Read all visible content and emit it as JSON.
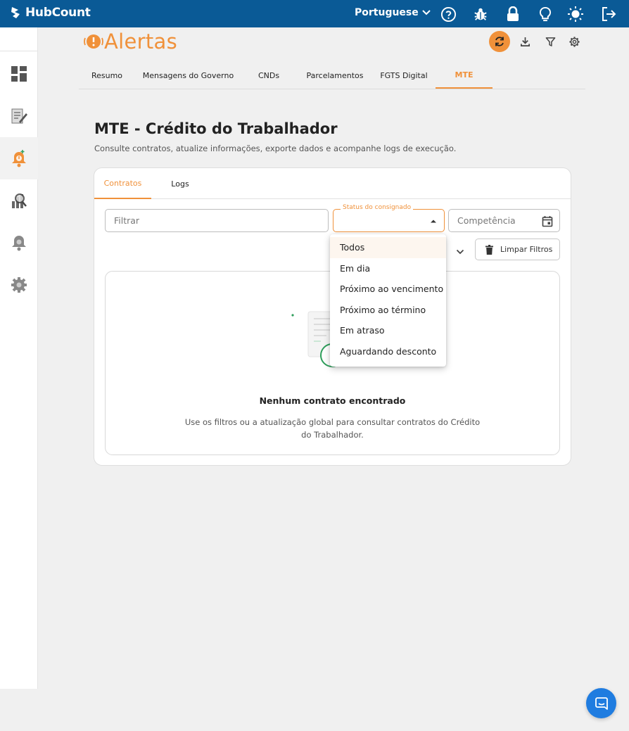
{
  "topbar": {
    "brand": "HubCount",
    "language": "Portuguese"
  },
  "header": {
    "module_title": "Alertas"
  },
  "tabs": [
    {
      "label": "Resumo"
    },
    {
      "label": "Mensagens do Governo"
    },
    {
      "label": "CNDs"
    },
    {
      "label": "Parcelamentos"
    },
    {
      "label": "FGTS Digital"
    },
    {
      "label": "MTE"
    }
  ],
  "active_tab": "MTE",
  "page": {
    "title": "MTE - Crédito do Trabalhador",
    "subtitle": "Consulte contratos, atualize informações, exporte dados e acompanhe logs de execução."
  },
  "subtabs": [
    {
      "label": "Contratos"
    },
    {
      "label": "Logs"
    }
  ],
  "filters": {
    "filter_placeholder": "Filtrar",
    "status_label": "Status do consignado",
    "status_value": "",
    "competencia_placeholder": "Competência",
    "clear_label": "Limpar Filtros"
  },
  "status_options": [
    "Todos",
    "Em dia",
    "Próximo ao vencimento",
    "Próximo ao término",
    "Em atraso",
    "Aguardando desconto"
  ],
  "empty_state": {
    "title": "Nenhum contrato encontrado",
    "description": "Use os filtros ou a atualização global para consultar contratos do Crédito do Trabalhador."
  },
  "colors": {
    "topbar": "#0a5a96",
    "accent": "#f0913a",
    "chat": "#1f7ce0"
  }
}
